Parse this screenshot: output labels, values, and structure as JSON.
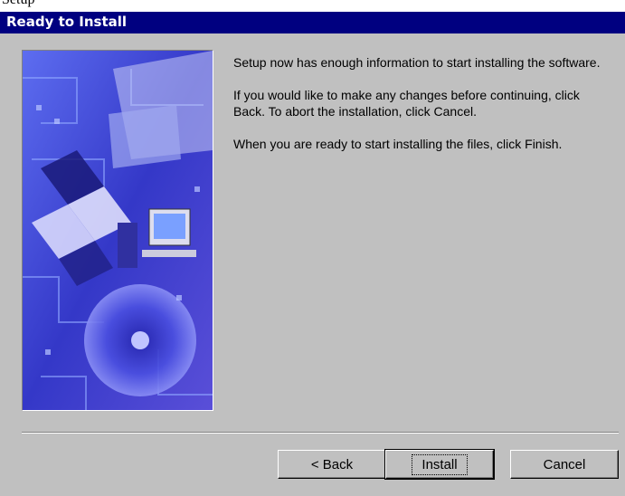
{
  "page_fragment": "Setup",
  "window": {
    "title": "Ready to Install"
  },
  "main": {
    "paragraphs": [
      "Setup now has enough information to start installing the software.",
      "If you would like to make any changes before continuing, click Back. To abort the installation, click Cancel.",
      "When you are ready to start installing the files, click Finish."
    ]
  },
  "buttons": {
    "back": "< Back",
    "install": "Install",
    "cancel": "Cancel"
  },
  "colors": {
    "titlebar": "#000080",
    "dialog_bg": "#c0c0c0",
    "banner_blue": "#3a3fd0"
  },
  "banner": {
    "icon": "setup-wizard-banner-icon"
  }
}
